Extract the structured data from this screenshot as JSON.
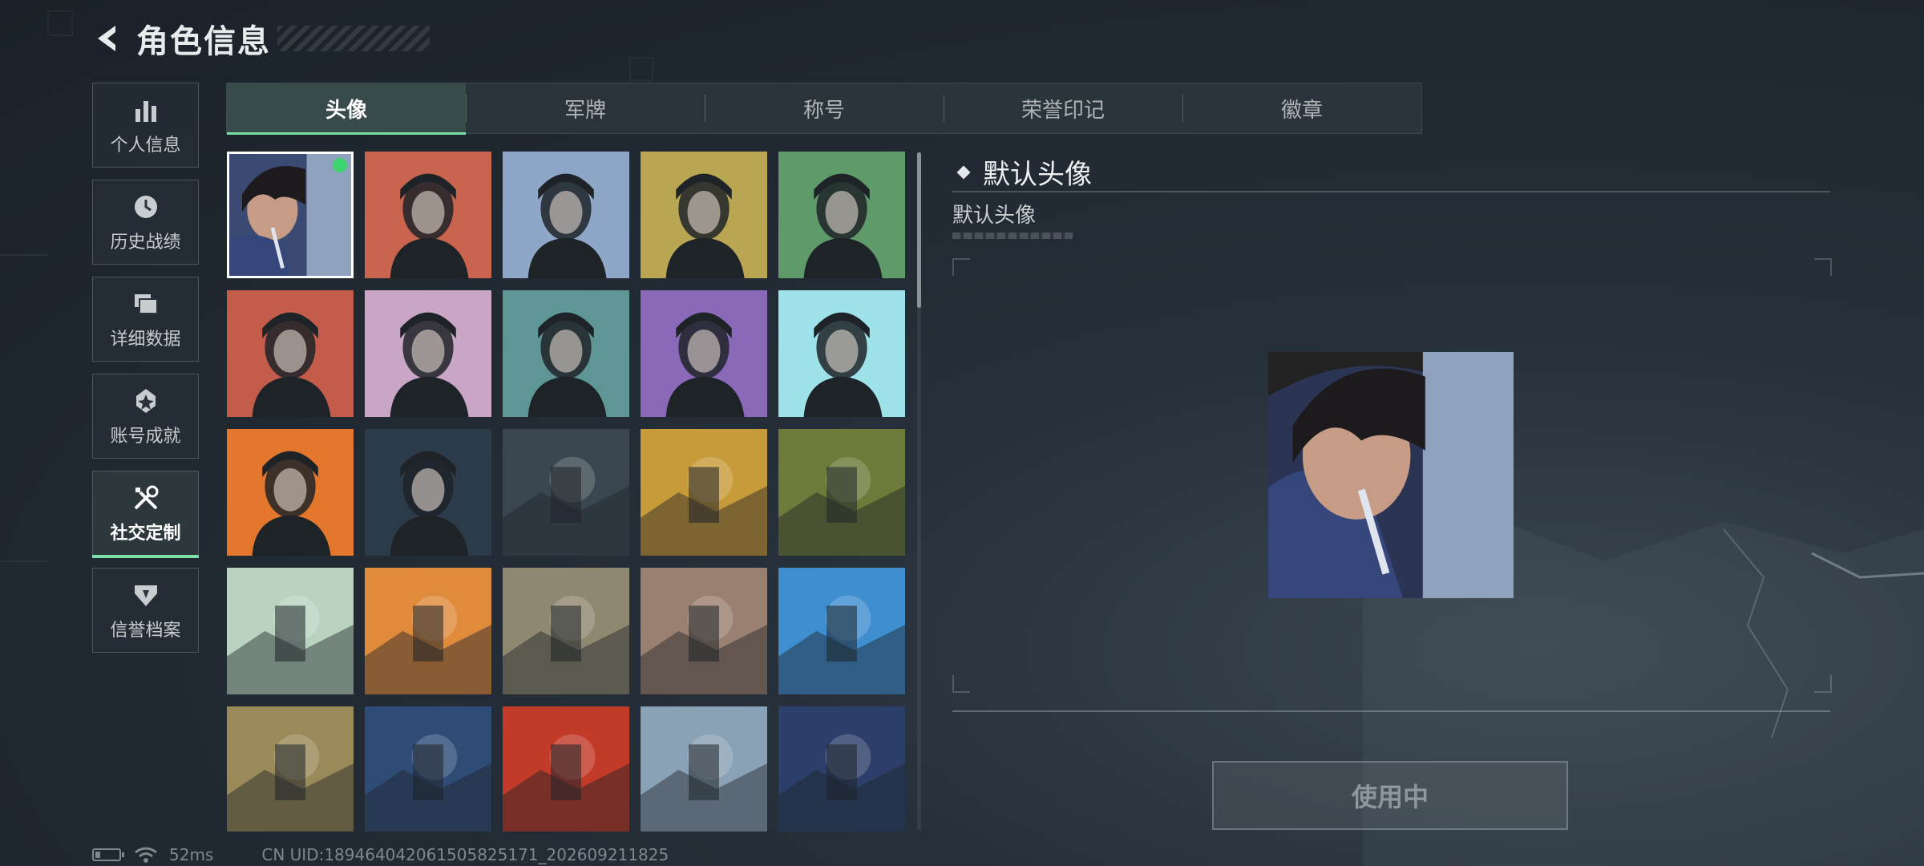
{
  "header": {
    "title": "角色信息",
    "back_icon": "back-arrow-icon"
  },
  "sidebar": {
    "items": [
      {
        "label": "个人信息",
        "icon": "bar-chart-icon",
        "active": false
      },
      {
        "label": "历史战绩",
        "icon": "history-clock-icon",
        "active": false
      },
      {
        "label": "详细数据",
        "icon": "folder-stack-icon",
        "active": false
      },
      {
        "label": "账号成就",
        "icon": "achievement-badge-icon",
        "active": false
      },
      {
        "label": "社交定制",
        "icon": "tools-wrench-icon",
        "active": true
      },
      {
        "label": "信誉档案",
        "icon": "reputation-shield-icon",
        "active": false
      }
    ]
  },
  "tabs": [
    {
      "label": "头像",
      "active": true
    },
    {
      "label": "军牌",
      "active": false
    },
    {
      "label": "称号",
      "active": false
    },
    {
      "label": "荣誉印记",
      "active": false
    },
    {
      "label": "徽章",
      "active": false
    }
  ],
  "avatars": [
    "default-photo",
    "soldier-cap-red",
    "pilot-blue",
    "bald-headset-olive",
    "headset-green",
    "helmet-red",
    "white-hair-pink",
    "beard-glasses-teal",
    "woman-purple",
    "masked-cyan",
    "masked-orange",
    "night-soldier",
    "scope-rifle",
    "comic-book",
    "exit-door",
    "way-out-sign",
    "feather-orange",
    "wrecked-truck",
    "scales-emblem",
    "bearded-eating",
    "soldier-rifle-desert",
    "man-lightning-tank",
    "redhead-woman",
    "mountain-binoculars",
    "archer-blue"
  ],
  "colors": {
    "accent_green": "#7be0a8",
    "selected_dot": "#3dd36e",
    "avatar_bg": [
      "#3b4a72",
      "#c9644f",
      "#8fa7c7",
      "#b8a653",
      "#5f9b6a",
      "#c45c4c",
      "#c9a6c5",
      "#5e9595",
      "#8a6ab8",
      "#9fe3ea",
      "#e2772d",
      "#2c3b4a",
      "#3a4750",
      "#c89b3a",
      "#6c7a3a",
      "#b9d3c0",
      "#e08a3c",
      "#8f8870",
      "#9a8070",
      "#3f8fd0",
      "#9a8a5a",
      "#2f4c77",
      "#c23a28",
      "#8aa2b5",
      "#2b3f6a"
    ]
  },
  "detail": {
    "title": "默认头像",
    "subtitle": "默认头像",
    "use_button": "使用中"
  },
  "status": {
    "ping": "52ms",
    "uid": "CN UID:18946404206150582517‌1_202609211825"
  }
}
